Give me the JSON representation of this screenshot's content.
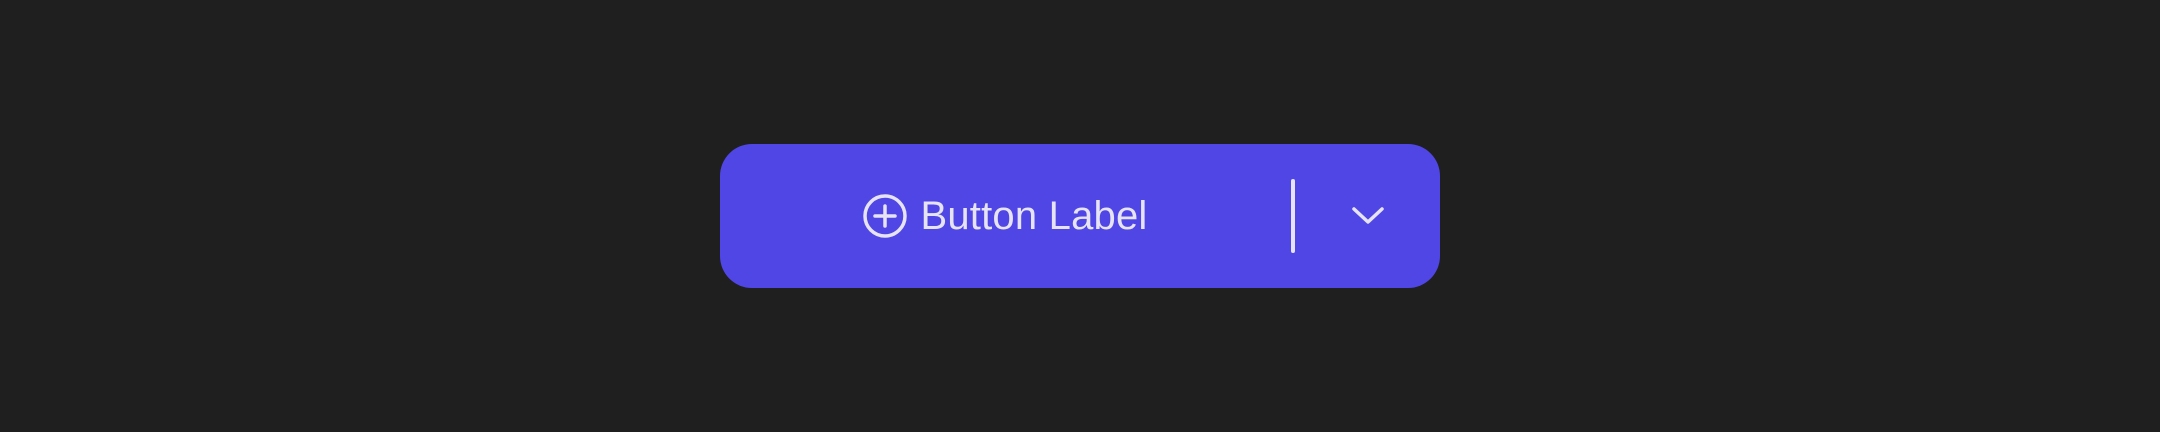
{
  "button": {
    "label": "Button Label",
    "leading_icon": "plus-circle-icon",
    "dropdown_icon": "chevron-down-icon"
  },
  "colors": {
    "background": "#1f1f1f",
    "button_fill": "#5046e5",
    "foreground": "#e6e3f2"
  }
}
